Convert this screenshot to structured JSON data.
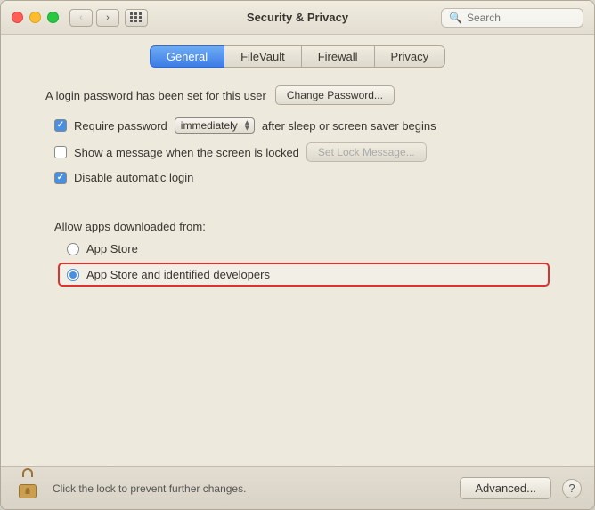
{
  "titlebar": {
    "title": "Security & Privacy",
    "search_placeholder": "Search"
  },
  "tabs": [
    {
      "id": "general",
      "label": "General",
      "active": true
    },
    {
      "id": "filevault",
      "label": "FileVault",
      "active": false
    },
    {
      "id": "firewall",
      "label": "Firewall",
      "active": false
    },
    {
      "id": "privacy",
      "label": "Privacy",
      "active": false
    }
  ],
  "general": {
    "login_password_label": "A login password has been set for this user",
    "change_password_btn": "Change Password...",
    "require_password_label": "Require password",
    "require_password_value": "immediately",
    "require_password_suffix": "after sleep or screen saver begins",
    "show_message_label": "Show a message when the screen is locked",
    "set_lock_message_btn": "Set Lock Message...",
    "disable_login_label": "Disable automatic login",
    "allow_apps_label": "Allow apps downloaded from:",
    "app_store_option": "App Store",
    "app_store_identified_option": "App Store and identified developers"
  },
  "bottom": {
    "lock_label": "Click the lock to prevent further changes.",
    "advanced_btn": "Advanced...",
    "question_mark": "?"
  },
  "checkboxes": {
    "require_password": true,
    "show_message": false,
    "disable_login": true
  },
  "radio": {
    "selected": "app_store_identified"
  }
}
